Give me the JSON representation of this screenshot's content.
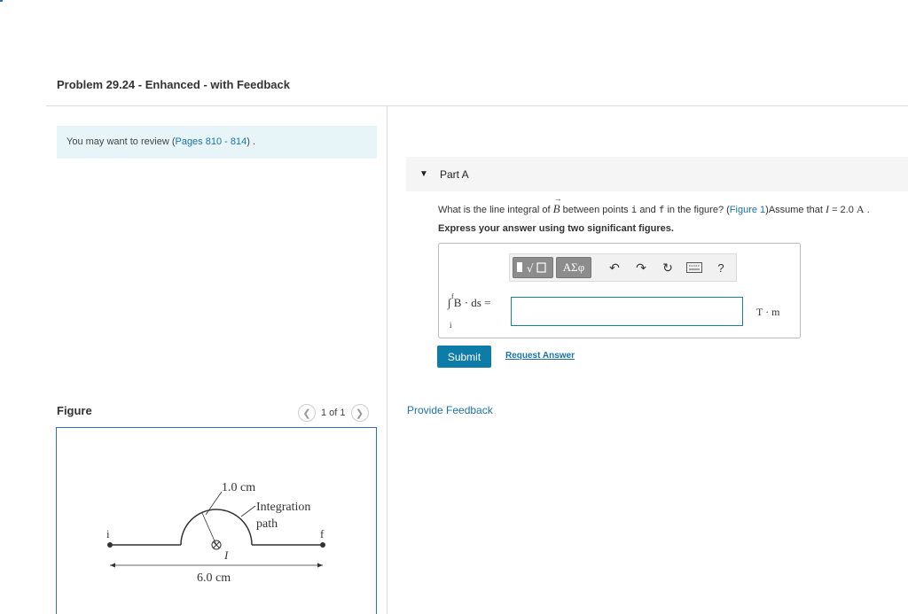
{
  "header": {
    "title": "Problem 29.24 - Enhanced - with Feedback"
  },
  "review": {
    "prefix": "You may want to review (",
    "pages": "Pages 810 - 814",
    "suffix": ") ."
  },
  "figure_panel": {
    "label": "Figure",
    "pager": "1 of 1",
    "prev_icon": "chevron-left-icon",
    "next_icon": "chevron-right-icon",
    "diagram": {
      "top_dimension": "1.0 cm",
      "path_label_line1": "Integration",
      "path_label_line2": "path",
      "start_point": "i",
      "end_point": "f",
      "current_label": "I",
      "bottom_dimension": "6.0 cm"
    }
  },
  "part": {
    "caret_icon": "caret-down-icon",
    "title": "Part A",
    "question": {
      "t1": "What is the line integral of ",
      "vec": "B",
      "t2": " between points ",
      "p1": "i",
      "t3": " and ",
      "p2": "f",
      "t4": " in the figure? (",
      "fig_link": "Figure 1",
      "t5": ")Assume that ",
      "var": "I",
      "t6": " = 2.0 ",
      "unit": "A",
      "t7": " ."
    },
    "instruction": "Express your answer using two significant figures."
  },
  "answer": {
    "toolbar": {
      "templates_icon": "radical-template-icon",
      "symbols_label": "ΑΣφ",
      "undo_icon": "undo-icon",
      "redo_icon": "redo-icon",
      "reset_icon": "reset-icon",
      "keyboard_icon": "keyboard-icon",
      "help_label": "?"
    },
    "equation_upper": "f",
    "equation": "∫ B · ds =",
    "equation_lower": "i",
    "input_value": "",
    "unit": "T · m"
  },
  "actions": {
    "submit_label": "Submit",
    "request_label": "Request Answer",
    "feedback_label": "Provide Feedback"
  },
  "colors": {
    "accent": "#0e7ca8",
    "link": "#1a73a8",
    "review_bg": "#e8f5f8",
    "figure_border": "#2d6fb8"
  }
}
